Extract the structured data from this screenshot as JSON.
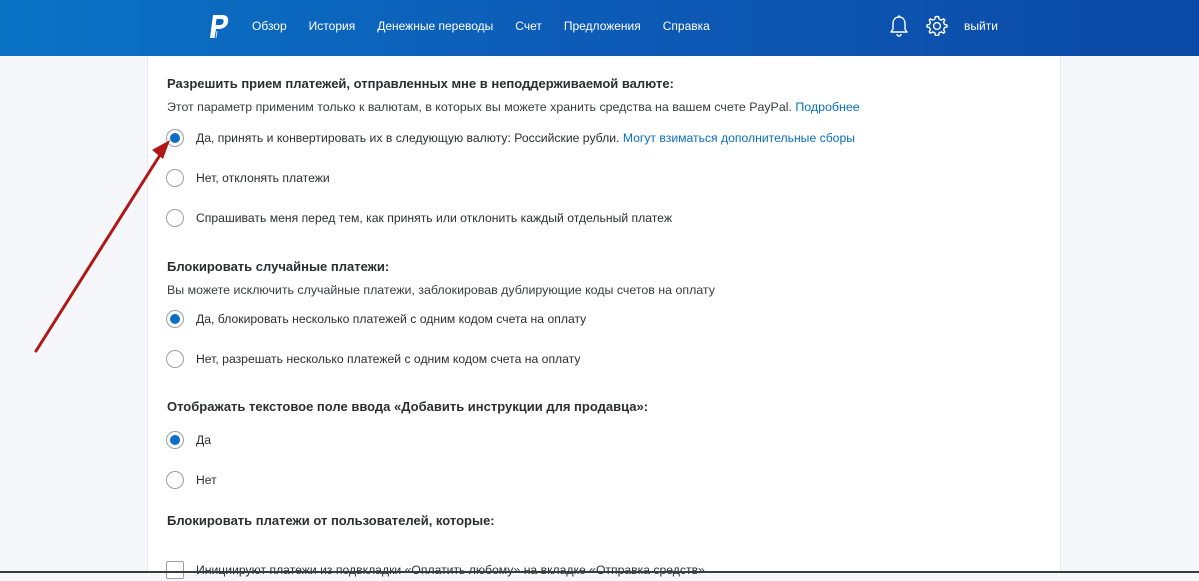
{
  "header": {
    "nav": [
      {
        "label": "Обзор"
      },
      {
        "label": "История"
      },
      {
        "label": "Денежные переводы"
      },
      {
        "label": "Счет"
      },
      {
        "label": "Предложения"
      },
      {
        "label": "Справка"
      }
    ],
    "logout_label": "выйти",
    "icons": [
      "paypal-logo",
      "bell-icon",
      "gear-icon"
    ]
  },
  "sections": {
    "currency": {
      "title": "Разрешить прием платежей, отправленных мне в неподдерживаемой валюте:",
      "description": "Этот параметр применим только к валютам, в которых вы можете хранить средства на вашем счете PayPal.",
      "description_link": "Подробнее",
      "options": [
        {
          "label": "Да, принять и конвертировать их в следующую валюту: Российские рубли.",
          "link": "Могут взиматься дополнительные сборы",
          "checked": true
        },
        {
          "label": "Нет, отклонять платежи",
          "checked": false
        },
        {
          "label": "Спрашивать меня перед тем, как принять или отклонить каждый отдельный платеж",
          "checked": false
        }
      ]
    },
    "duplicates": {
      "title": "Блокировать случайные платежи:",
      "description": "Вы можете исключить случайные платежи, заблокировав дублирующие коды счетов на оплату",
      "options": [
        {
          "label": "Да, блокировать несколько платежей с одним кодом счета на оплату",
          "checked": true
        },
        {
          "label": "Нет, разрешать несколько платежей с одним кодом счета на оплату",
          "checked": false
        }
      ]
    },
    "instructions": {
      "title": "Отображать текстовое поле ввода «Добавить инструкции для продавца»:",
      "options": [
        {
          "label": "Да",
          "checked": true
        },
        {
          "label": "Нет",
          "checked": false
        }
      ]
    },
    "block_users": {
      "title": "Блокировать платежи от пользователей, которые:",
      "options": [
        {
          "label": "Инициируют платежи из подвкладки «Оплатить любому» на вкладке «Отправка средств»",
          "checked": false
        }
      ]
    }
  },
  "colors": {
    "header_start": "#0a73c6",
    "header_end": "#0b49a6",
    "link": "#0a6ec4",
    "radio_checked": "#0a6ec4",
    "annotation_arrow": "#b01818"
  }
}
